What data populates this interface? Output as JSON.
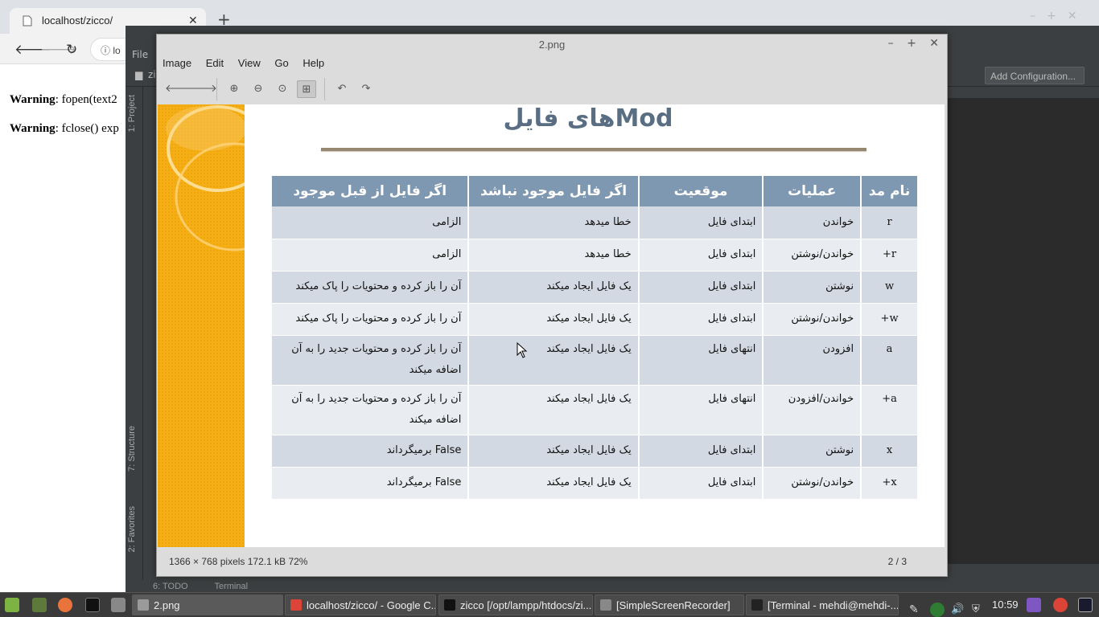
{
  "browser": {
    "tab_title": "localhost/zicco/",
    "tab_close": "✕",
    "new_tab": "+",
    "url_fragment": "lo",
    "page_lines": [
      {
        "label": "Warning",
        "text": ": fopen(text2"
      },
      {
        "label": "Warning",
        "text": ": fclose() exp"
      }
    ]
  },
  "ide": {
    "menu_file": "File",
    "add_config": "Add Configuration...",
    "side_tabs": [
      "1: Project",
      "7: Structure",
      "2: Favorites"
    ],
    "bottom_tabs": [
      "6: TODO",
      "Terminal"
    ],
    "folder_label": "zi"
  },
  "viewer": {
    "window_title": "2.png",
    "menu": [
      "Image",
      "Edit",
      "View",
      "Go",
      "Help"
    ],
    "status_info": "1366 × 768 pixels   172.1 kB    72%",
    "status_page": "2 / 3"
  },
  "slide": {
    "title": "Modهای فایل",
    "headers": [
      "نام مد",
      "عملیات",
      "موقعیت",
      "اگر فایل موجود نباشد",
      "اگر فایل از قبل موجود"
    ],
    "rows": [
      {
        "mode": "r",
        "op": "خواندن",
        "pos": "ابتدای فایل",
        "missing": "خطا میدهد",
        "exists": "الزامی"
      },
      {
        "mode": "r+",
        "op": "خواندن/نوشتن",
        "pos": "ابتدای فایل",
        "missing": "خطا میدهد",
        "exists": "الزامی"
      },
      {
        "mode": "w",
        "op": "نوشتن",
        "pos": "ابتدای فایل",
        "missing": "یک فایل ایجاد میکند",
        "exists": "آن را باز کرده و محتویات را پاک میکند"
      },
      {
        "mode": "w+",
        "op": "خواندن/نوشتن",
        "pos": "ابتدای فایل",
        "missing": "یک فایل ایجاد میکند",
        "exists": "آن را باز کرده و محتویات را پاک میکند"
      },
      {
        "mode": "a",
        "op": "افزودن",
        "pos": "انتهای فایل",
        "missing": "یک فایل ایجاد میکند",
        "exists": "آن را باز کرده و محتویات جدید را به آن اضافه میکند"
      },
      {
        "mode": "a+",
        "op": "خواندن/افزودن",
        "pos": "انتهای فایل",
        "missing": "یک فایل ایجاد میکند",
        "exists": "آن را باز کرده و محتویات جدید را به آن اضافه میکند"
      },
      {
        "mode": "x",
        "op": "نوشتن",
        "pos": "ابتدای فایل",
        "missing": "یک فایل ایجاد میکند",
        "exists": "False برمیگرداند"
      },
      {
        "mode": "x+",
        "op": "خواندن/نوشتن",
        "pos": "ابتدای فایل",
        "missing": "یک فایل ایجاد میکند",
        "exists": "False برمیگرداند"
      }
    ]
  },
  "taskbar": {
    "tasks": [
      {
        "label": "2.png",
        "icon": "image-viewer-icon",
        "color": "#9a9a9a"
      },
      {
        "label": "localhost/zicco/ - Google C...",
        "icon": "chrome-icon",
        "color": "#db4437"
      },
      {
        "label": "zicco [/opt/lampp/htdocs/zi...",
        "icon": "phpstorm-icon",
        "color": "#111111"
      },
      {
        "label": "[SimpleScreenRecorder]",
        "icon": "recorder-icon",
        "color": "#888888"
      },
      {
        "label": "[Terminal - mehdi@mehdi-...",
        "icon": "terminal-icon",
        "color": "#222222"
      }
    ],
    "clock": "10:59"
  }
}
